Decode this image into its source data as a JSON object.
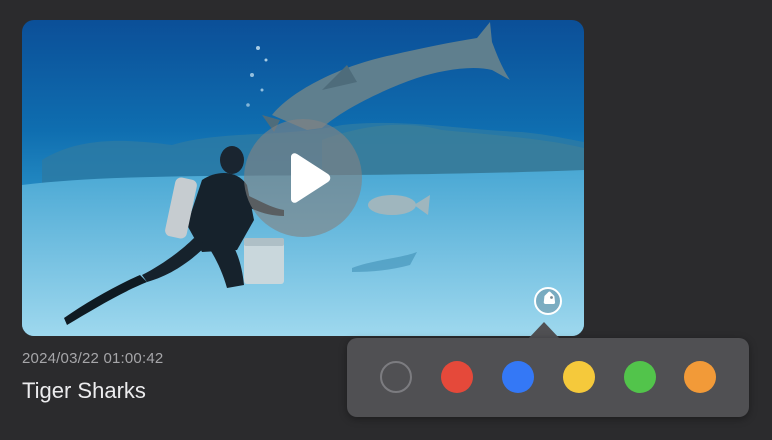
{
  "video": {
    "timestamp": "2024/03/22 01:00:42",
    "title": "Tiger Sharks",
    "play_icon": "play-icon",
    "tag_icon": "tag-icon"
  },
  "color_picker": {
    "swatches": [
      {
        "name": "none",
        "color": "transparent"
      },
      {
        "name": "red",
        "color": "#e5493a"
      },
      {
        "name": "blue",
        "color": "#3478f6"
      },
      {
        "name": "yellow",
        "color": "#f5c93b"
      },
      {
        "name": "green",
        "color": "#52c44b"
      },
      {
        "name": "orange",
        "color": "#f29a38"
      }
    ]
  }
}
